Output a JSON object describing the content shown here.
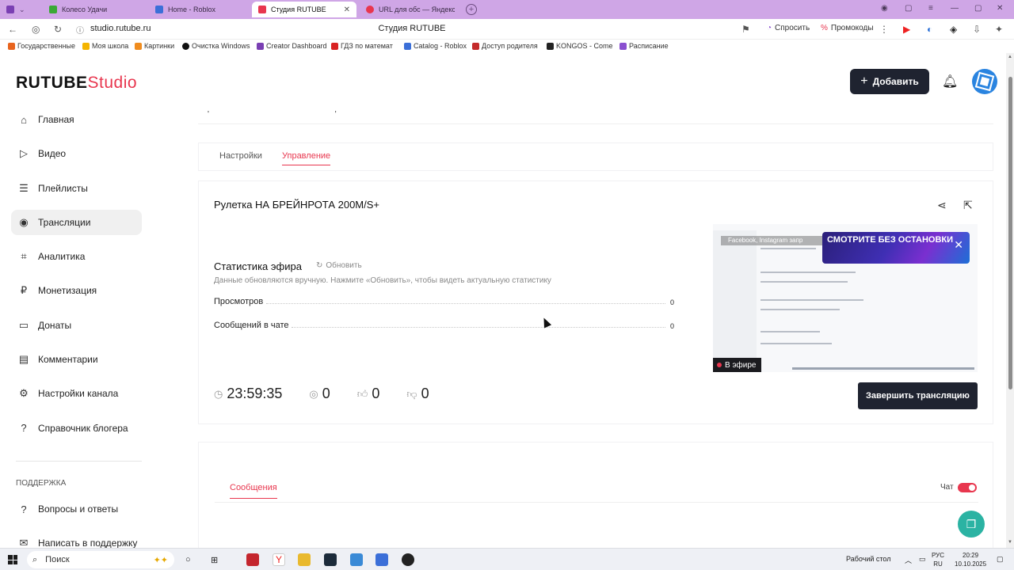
{
  "browser": {
    "tabs": [
      {
        "label": "Колесо Удачи",
        "fav": "#3aa935"
      },
      {
        "label": "Home - Roblox",
        "fav": "#3b6fd8"
      },
      {
        "label": "Студия RUTUBE",
        "fav": "#e8364e"
      },
      {
        "label": "URL для обс — Яндекс: на",
        "fav": "#e8364e"
      }
    ],
    "url": "studio.rutube.ru",
    "page_title": "Студия RUTUBE",
    "ask_label": "Спросить",
    "promo_label": "Промокоды",
    "bookmarks": [
      "Государственные",
      "Моя школа",
      "Картинки",
      "Очистка Windows",
      "Creator Dashboard",
      "ГДЗ по математ",
      "Catalog - Roblox",
      "Доступ родителя",
      "KONGOS - Come",
      "Расписание"
    ]
  },
  "header": {
    "logo_main": "RUTUBE",
    "logo_sub": "Studio",
    "add_label": "Добавить"
  },
  "sidebar": {
    "items": [
      {
        "label": "Главная",
        "icon": "home-icon"
      },
      {
        "label": "Видео",
        "icon": "video-icon"
      },
      {
        "label": "Плейлисты",
        "icon": "playlist-icon"
      },
      {
        "label": "Трансляции",
        "icon": "broadcast-icon"
      },
      {
        "label": "Аналитика",
        "icon": "analytics-icon"
      },
      {
        "label": "Монетизация",
        "icon": "monetization-icon"
      },
      {
        "label": "Донаты",
        "icon": "donate-icon"
      },
      {
        "label": "Комментарии",
        "icon": "comments-icon"
      },
      {
        "label": "Настройки канала",
        "icon": "settings-icon"
      },
      {
        "label": "Справочник блогера",
        "icon": "help-icon"
      }
    ],
    "support_heading": "ПОДДЕРЖКА",
    "support_items": [
      {
        "label": "Вопросы и ответы",
        "icon": "faq-icon"
      },
      {
        "label": "Написать в поддержку",
        "icon": "mail-icon"
      }
    ]
  },
  "tabs": {
    "settings": "Настройки",
    "manage": "Управление"
  },
  "stream": {
    "title": "Рулетка НА БРЕЙНРОТА 200M/S+",
    "stats_title": "Статистика эфира",
    "refresh_label": "Обновить",
    "stats_note": "Данные обновляются вручную. Нажмите «Обновить», чтобы видеть актуальную статистику",
    "views_label": "Просмотров",
    "views_value": "0",
    "chat_messages_label": "Сообщений в чате",
    "chat_messages_value": "0",
    "live_label": "В эфире",
    "preview_banner": "СМОТРИТЕ БЕЗ ОСТАНОВКИ",
    "preview_fb": "Facebook, Instagram запр",
    "duration": "23:59:35",
    "viewers": "0",
    "likes": "0",
    "dislikes": "0",
    "end_label": "Завершить трансляцию"
  },
  "chat": {
    "tab_label": "Сообщения",
    "toggle_label": "Чат",
    "enabled": true
  },
  "taskbar": {
    "search_placeholder": "Поиск",
    "desktop_label": "Рабочий стол",
    "lang": "РУС",
    "lang_sub": "RU",
    "time": "20:29",
    "date": "10.10.2025"
  },
  "colors": {
    "accent": "#e8364e",
    "dark_button": "#1f2330",
    "browser_tabbar": "#cfa6e6"
  }
}
